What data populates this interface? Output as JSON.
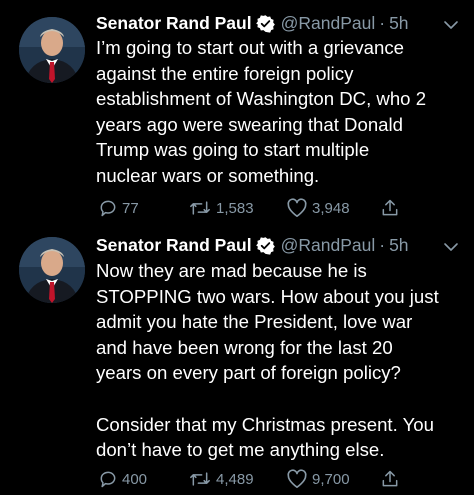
{
  "tweets": [
    {
      "author_name": "Senator Rand Paul",
      "handle": "@RandPaul",
      "separator": "·",
      "time": "5h",
      "text": "I’m going to start out with a grievance\nagainst the entire foreign policy\nestablishment of Washington DC, who 2\nyears ago were swearing that Donald\nTrump was going to start multiple\nnuclear wars or something.",
      "reply_count": "77",
      "retweet_count": "1,583",
      "like_count": "3,948"
    },
    {
      "author_name": "Senator Rand Paul",
      "handle": "@RandPaul",
      "separator": "·",
      "time": "5h",
      "text": "Now they are mad because he is\nSTOPPING two wars.  How about you just\nadmit you hate the President, love war\nand have been wrong for the last 20\nyears on every part of foreign policy?\n\nConsider that my Christmas present. You\ndon’t have to get me anything else.",
      "reply_count": "400",
      "retweet_count": "4,489",
      "like_count": "9,700"
    }
  ],
  "icons": {
    "verified": "verified-badge-icon",
    "caret": "chevron-down-icon",
    "reply": "reply-icon",
    "retweet": "retweet-icon",
    "like": "heart-icon",
    "share": "share-icon"
  },
  "colors": {
    "background": "#000000",
    "text": "#ffffff",
    "secondary": "#8899a6",
    "verified": "#1da1f2"
  }
}
